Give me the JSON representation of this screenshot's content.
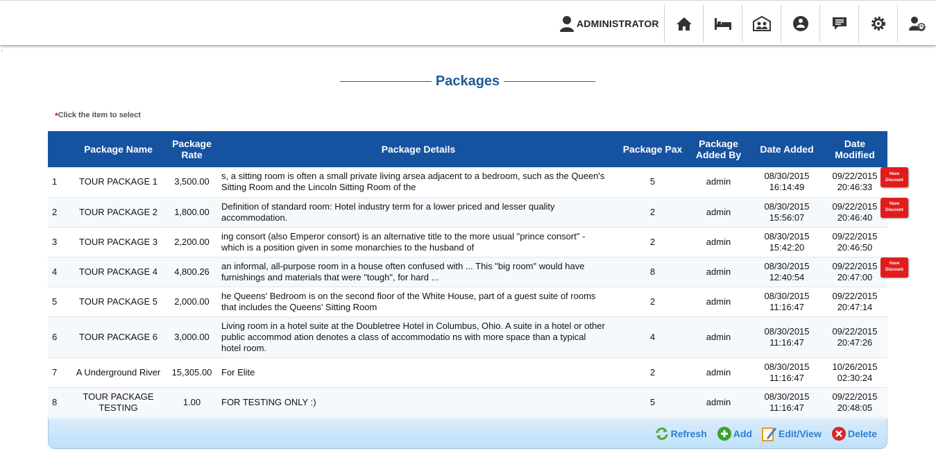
{
  "header": {
    "user_label": "ADMINISTRATOR",
    "nav_icons": [
      "home-icon",
      "bed-icon",
      "guests-icon",
      "tour-icon",
      "messages-icon",
      "settings-icon",
      "logout-icon"
    ]
  },
  "stray_mark": "`",
  "page": {
    "title": "Packages",
    "hint_star": "*",
    "hint": "Click the item to select"
  },
  "table": {
    "columns": [
      "",
      "Package Name",
      "Package Rate",
      "Package Details",
      "Package Pax",
      "Package Added By",
      "Date Added",
      "Date Modified"
    ],
    "badge_text": "Have Discount",
    "rows": [
      {
        "no": "1",
        "name": "TOUR PACKAGE 1",
        "rate": "3,500.00",
        "details": "s, a sitting room is often a small private living arsea adjacent to a bedroom, such as the Queen's Sitting Room and the Lincoln Sitting Room of the",
        "pax": "5",
        "added_by": "admin",
        "date_added": "08/30/2015 16:14:49",
        "date_modified": "09/22/2015 20:46:33",
        "discount": true
      },
      {
        "no": "2",
        "name": "TOUR PACKAGE 2",
        "rate": "1,800.00",
        "details": "Definition of standard room: Hotel industry term for a lower priced and lesser quality accommodation.",
        "pax": "2",
        "added_by": "admin",
        "date_added": "08/30/2015 15:56:07",
        "date_modified": "09/22/2015 20:46:40",
        "discount": true
      },
      {
        "no": "3",
        "name": "TOUR PACKAGE 3",
        "rate": "2,200.00",
        "details": "ing consort (also Emperor consort) is an alternative title to the more usual \"prince consort\" - which is a position given in some monarchies to the husband of",
        "pax": "2",
        "added_by": "admin",
        "date_added": "08/30/2015 15:42:20",
        "date_modified": "09/22/2015 20:46:50",
        "discount": false
      },
      {
        "no": "4",
        "name": "TOUR PACKAGE 4",
        "rate": "4,800.26",
        "details": "an informal, all-purpose room in a house often confused with ... This \"big room\" would have furnishings and materials that were \"tough\", for hard ...",
        "pax": "8",
        "added_by": "admin",
        "date_added": "08/30/2015 12:40:54",
        "date_modified": "09/22/2015 20:47:00",
        "discount": true
      },
      {
        "no": "5",
        "name": "TOUR PACKAGE 5",
        "rate": "2,000.00",
        "details": "he Queens' Bedroom is on the second floor of the White House, part of a guest suite of rooms that includes the Queens' Sitting Room",
        "pax": "2",
        "added_by": "admin",
        "date_added": "08/30/2015 11:16:47",
        "date_modified": "09/22/2015 20:47:14",
        "discount": false
      },
      {
        "no": "6",
        "name": "TOUR PACKAGE 6",
        "rate": "3,000.00",
        "details": "Living room in a hotel suite at the Doubletree Hotel in Columbus, Ohio. A suite in a hotel or other public accommod ation denotes a class of accommodatio ns with more space than a typical hotel room.",
        "pax": "4",
        "added_by": "admin",
        "date_added": "08/30/2015 11:16:47",
        "date_modified": "09/22/2015 20:47:26",
        "discount": false
      },
      {
        "no": "7",
        "name": "A Underground River",
        "rate": "15,305.00",
        "details": "For Elite",
        "pax": "2",
        "added_by": "admin",
        "date_added": "08/30/2015 11:16:47",
        "date_modified": "10/26/2015 02:30:24",
        "discount": false
      },
      {
        "no": "8",
        "name": "TOUR PACKAGE TESTING",
        "rate": "1.00",
        "details": "FOR TESTING ONLY :)",
        "pax": "5",
        "added_by": "admin",
        "date_added": "08/30/2015 11:16:47",
        "date_modified": "09/22/2015 20:48:05",
        "discount": false
      }
    ]
  },
  "footer": {
    "refresh": "Refresh",
    "add": "Add",
    "edit": "Edit/View",
    "delete": "Delete"
  },
  "colors": {
    "header_bg": "#1552a0",
    "title": "#1a5b97",
    "badge": "#e21c1c",
    "action_text": "#2d7fd1"
  }
}
